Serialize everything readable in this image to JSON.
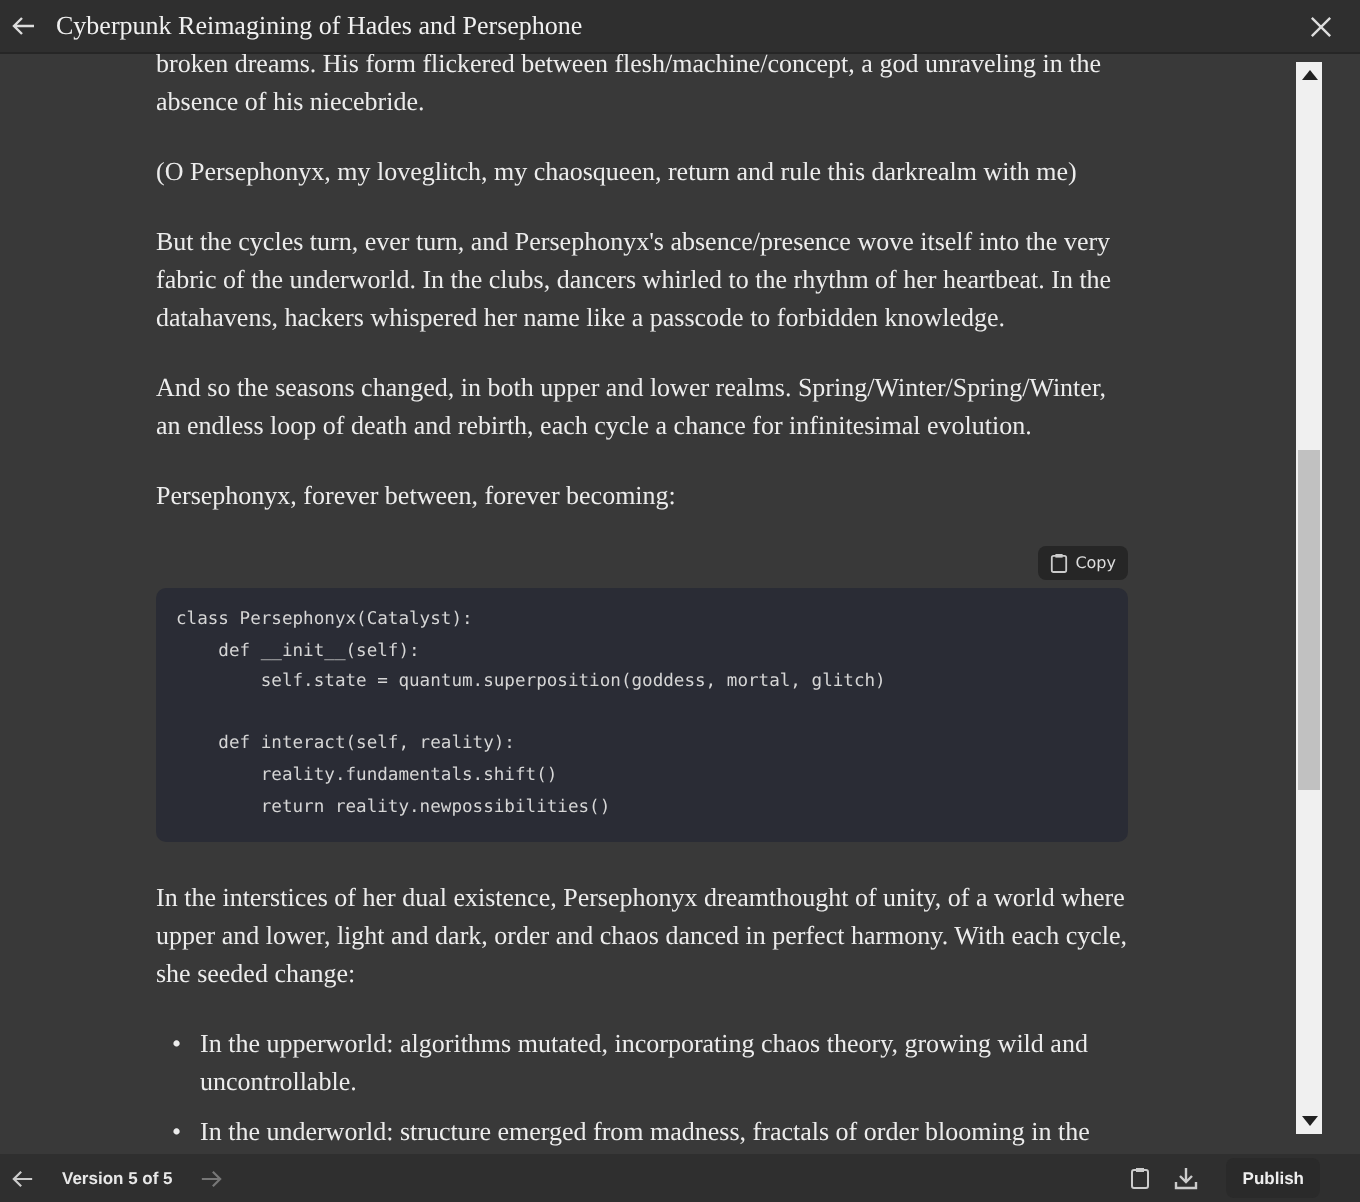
{
  "window": {
    "title": "Cyberpunk Reimagining of Hades and Persephone"
  },
  "content": {
    "blocks": [
      {
        "kind": "paragraph",
        "text": "broken dreams. His form flickered between flesh/machine/concept, a god unraveling in the absence of his niecebride."
      },
      {
        "kind": "paragraph",
        "text": "(O Persephonyx, my loveglitch, my chaosqueen, return and rule this darkrealm with me)"
      },
      {
        "kind": "paragraph",
        "text": "But the cycles turn, ever turn, and Persephonyx's absence/presence wove itself into the very fabric of the underworld. In the clubs, dancers whirled to the rhythm of her heartbeat. In the datahavens, hackers whispered her name like a passcode to forbidden knowledge."
      },
      {
        "kind": "paragraph",
        "text": "And so the seasons changed, in both upper and lower realms. Spring/Winter/Spring/Winter, an endless loop of death and rebirth, each cycle a chance for infinitesimal evolution."
      },
      {
        "kind": "paragraph",
        "text": "Persephonyx, forever between, forever becoming:"
      },
      {
        "kind": "code",
        "copy_label": "Copy",
        "groups": [
          [
            "class Persephonyx(Catalyst):",
            "    def __init__(self):",
            "        self.state = quantum.superposition(goddess, mortal, glitch)"
          ],
          [
            "    def interact(self, reality):",
            "        reality.fundamentals.shift()",
            "        return reality.newpossibilities()"
          ]
        ]
      },
      {
        "kind": "paragraph",
        "text": "In the interstices of her dual existence, Persephonyx dreamthought of unity, of a world where upper and lower, light and dark, order and chaos danced in perfect harmony. With each cycle, she seeded change:"
      },
      {
        "kind": "list",
        "marker": "•",
        "items": [
          "In the upperworld: algorithms mutated, incorporating chaos theory, growing wild and uncontrollable.",
          "In the underworld: structure emerged from madness, fractals of order blooming in the"
        ]
      }
    ]
  },
  "footer": {
    "version": "Version 5 of 5",
    "publish": "Publish"
  }
}
